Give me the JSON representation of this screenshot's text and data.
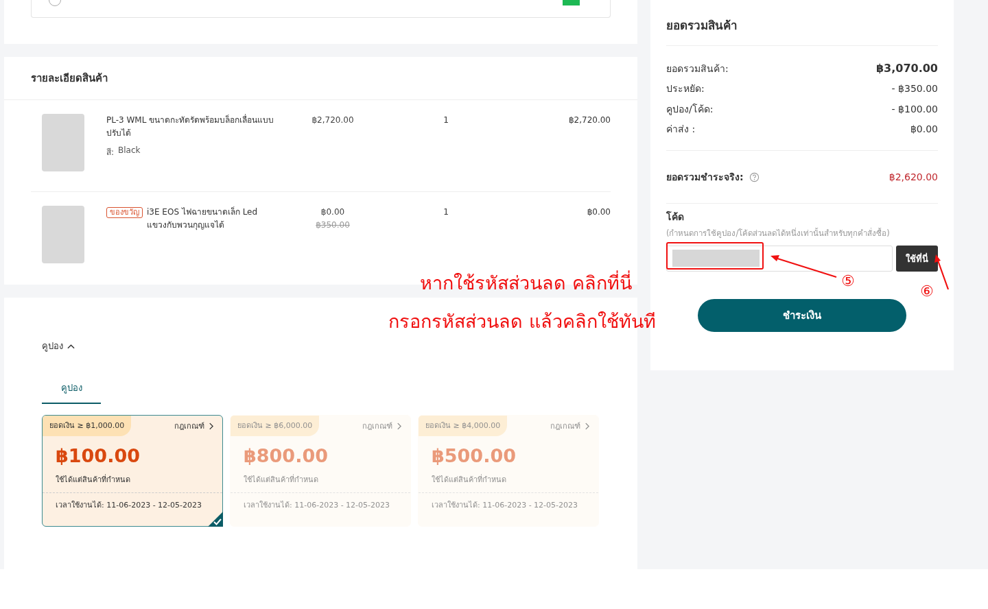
{
  "payment_option": {
    "selected": false
  },
  "product_details": {
    "title": "รายละเอียดสินค้า",
    "items": [
      {
        "name": "PL-3 WML ขนาดกะทัดรัดพร้อมบล็อกเลื่อนแบบปรับได้",
        "variant_label": "สี:",
        "variant_value": "Black",
        "unit_price": "฿2,720.00",
        "quantity": "1",
        "total": "฿2,720.00"
      },
      {
        "tag": "ของขวัญ",
        "name": "i3E EOS ไฟฉายขนาดเล็ก Led แขวงกับพวนกุญแจได้",
        "unit_price": "฿0.00",
        "original_price": "฿350.00",
        "quantity": "1",
        "total": "฿0.00"
      }
    ]
  },
  "coupons": {
    "toggle": {
      "label": "คูปอง",
      "expanded": true
    },
    "tabs": [
      {
        "label": "คูปอง",
        "selected": true
      }
    ],
    "items": [
      {
        "condition": "ยอดเงิน ≥ ฿1,000.00",
        "rules": "กฎเกณฑ์",
        "amount": "฿100.00",
        "scope": "ใช้ได้แต่สินค้าที่กำหนด",
        "validity": "เวลาใช้งานได้: 11-06-2023 - 12-05-2023",
        "selected": true,
        "disabled": false
      },
      {
        "condition": "ยอดเงิน ≥ ฿6,000.00",
        "rules": "กฎเกณฑ์",
        "amount": "฿800.00",
        "scope": "ใช้ได้แต่สินค้าที่กำหนด",
        "validity": "เวลาใช้งานได้: 11-06-2023 - 12-05-2023",
        "selected": false,
        "disabled": true
      },
      {
        "condition": "ยอดเงิน ≥ ฿4,000.00",
        "rules": "กฎเกณฑ์",
        "amount": "฿500.00",
        "scope": "ใช้ได้แต่สินค้าที่กำหนด",
        "validity": "เวลาใช้งานได้: 11-06-2023 - 12-05-2023",
        "selected": false,
        "disabled": true
      }
    ]
  },
  "summary": {
    "title": "ยอดรวมสินค้า",
    "rows": [
      {
        "kind": "subtotal",
        "label": "ยอดรวมสินค้า:",
        "value": "฿3,070.00"
      },
      {
        "kind": "plain",
        "label": "ประหยัด:",
        "value": "- ฿350.00"
      },
      {
        "kind": "plain",
        "label": "คูปอง/โค้ด:",
        "value": "- ฿100.00"
      },
      {
        "kind": "plain",
        "label": "ค่าส่ง :",
        "value": "฿0.00"
      }
    ],
    "total": {
      "label": "ยอดรวมชำระจริง:",
      "value": "฿2,620.00"
    },
    "code": {
      "title": "โค้ด",
      "hint": "(กำหนดการใช้คูปอง/โค้ดส่วนลดได้หนึ่งเท่านั้นสำหรับทุกคำสั่งซื้อ)",
      "apply_button": "ใช้ที่นี่"
    },
    "pay_button": "ชำระเงิน"
  },
  "annotations": {
    "lines": [
      "หากใช้รหัสส่วนลด คลิกที่นี่",
      "กรอกรหัสส่วนลด แล้วคลิกใช้ทันที"
    ],
    "markers": [
      "⑤",
      "⑥"
    ]
  }
}
